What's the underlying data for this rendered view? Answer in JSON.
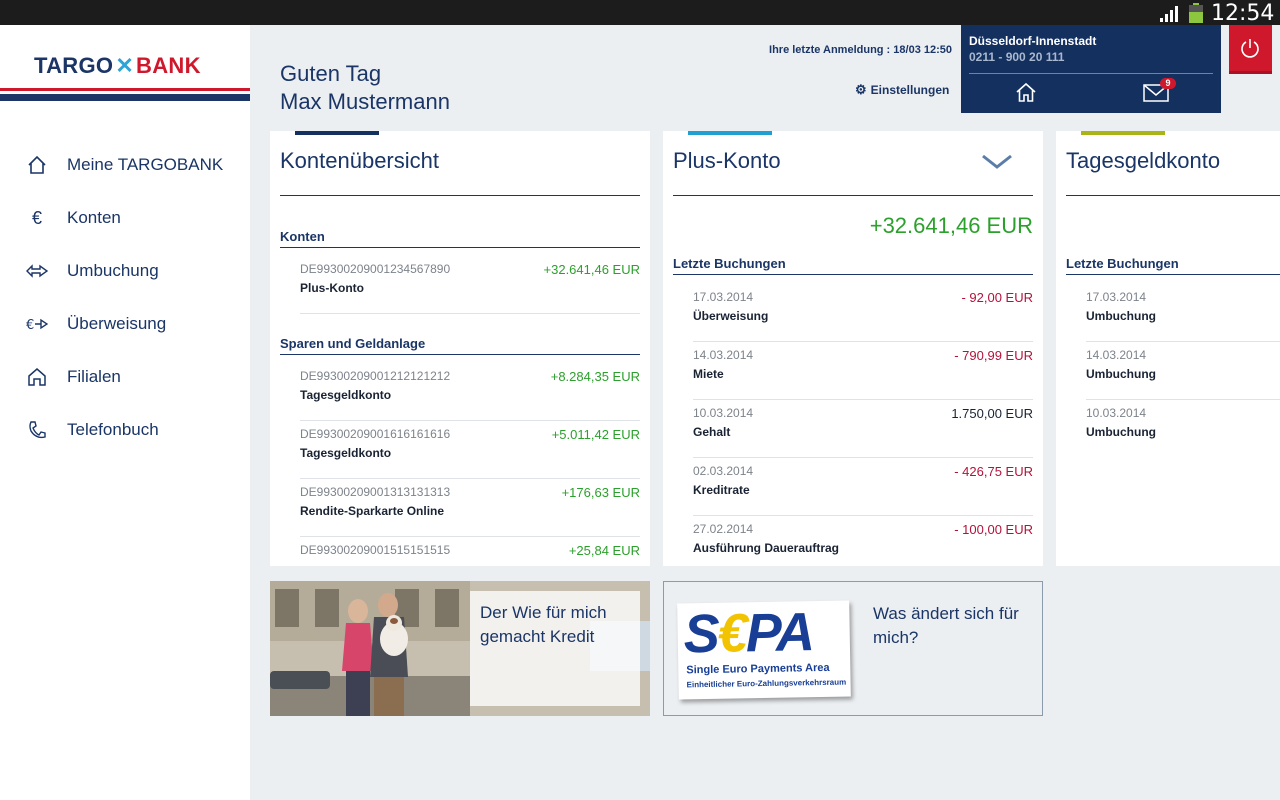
{
  "status_bar": {
    "time": "12:54"
  },
  "brand": {
    "part1": "TARGO",
    "part2": "BANK"
  },
  "sidebar": {
    "items": [
      {
        "label": "Meine TARGOBANK",
        "icon": "home-icon"
      },
      {
        "label": "Konten",
        "icon": "euro-icon"
      },
      {
        "label": "Umbuchung",
        "icon": "transfer-arrows-icon"
      },
      {
        "label": "Überweisung",
        "icon": "euro-arrow-icon"
      },
      {
        "label": "Filialen",
        "icon": "branch-house-icon"
      },
      {
        "label": "Telefonbuch",
        "icon": "phone-icon"
      }
    ]
  },
  "header": {
    "greeting_line1": "Guten Tag",
    "greeting_line2": "Max Mustermann",
    "last_login": "Ihre letzte Anmeldung : 18/03 12:50",
    "settings_label": "Einstellungen"
  },
  "branch": {
    "name": "Düsseldorf-Innenstadt",
    "phone": "0211 - 900 20 111",
    "mail_count": "9"
  },
  "colors": {
    "navy": "#1a3566",
    "red": "#d0182d",
    "positive": "#2ca02c",
    "negative": "#b3123a",
    "tab_overview": "#14305f",
    "tab_plus": "#1fa0d0",
    "tab_tagesgeld": "#a9b417"
  },
  "overview": {
    "title": "Kontenübersicht",
    "section1": "Konten",
    "accounts": [
      {
        "iban": "DE99300209001234567890",
        "name": "Plus-Konto",
        "amount": "+32.641,46 EUR"
      }
    ],
    "section2": "Sparen und Geldanlage",
    "savings": [
      {
        "iban": "DE99300209001212121212",
        "name": "Tagesgeldkonto",
        "amount": "+8.284,35 EUR"
      },
      {
        "iban": "DE99300209001616161616",
        "name": "Tagesgeldkonto",
        "amount": "+5.011,42 EUR"
      },
      {
        "iban": "DE99300209001313131313",
        "name": "Rendite-Sparkarte Online",
        "amount": "+176,63 EUR"
      },
      {
        "iban": "DE99300209001515151515",
        "name": "",
        "amount": "+25,84 EUR"
      }
    ]
  },
  "plus_konto": {
    "title": "Plus-Konto",
    "balance": "+32.641,46 EUR",
    "section": "Letzte Buchungen",
    "bookings": [
      {
        "date": "17.03.2014",
        "text": "Überweisung",
        "amount": "- 92,00 EUR",
        "type": "neg"
      },
      {
        "date": "14.03.2014",
        "text": "Miete",
        "amount": "- 790,99 EUR",
        "type": "neg"
      },
      {
        "date": "10.03.2014",
        "text": "Gehalt",
        "amount": "1.750,00 EUR",
        "type": "neu"
      },
      {
        "date": "02.03.2014",
        "text": "Kreditrate",
        "amount": "- 426,75 EUR",
        "type": "neg"
      },
      {
        "date": "27.02.2014",
        "text": "Ausführung Dauerauftrag",
        "amount": "- 100,00 EUR",
        "type": "neg"
      }
    ]
  },
  "tagesgeld": {
    "title": "Tagesgeldkonto",
    "section": "Letzte Buchungen",
    "bookings": [
      {
        "date": "17.03.2014",
        "text": "Umbuchung"
      },
      {
        "date": "14.03.2014",
        "text": "Umbuchung"
      },
      {
        "date": "10.03.2014",
        "text": "Umbuchung"
      }
    ]
  },
  "banners": {
    "kredit_text": "Der Wie für mich gemacht Kredit",
    "sepa_logo_s": "S",
    "sepa_logo_euro": "€",
    "sepa_logo_pa": "PA",
    "sepa_sub1": "Single Euro Payments Area",
    "sepa_sub2": "Einheitlicher Euro-Zahlungsverkehrsraum",
    "sepa_text": "Was ändert sich für mich?"
  }
}
